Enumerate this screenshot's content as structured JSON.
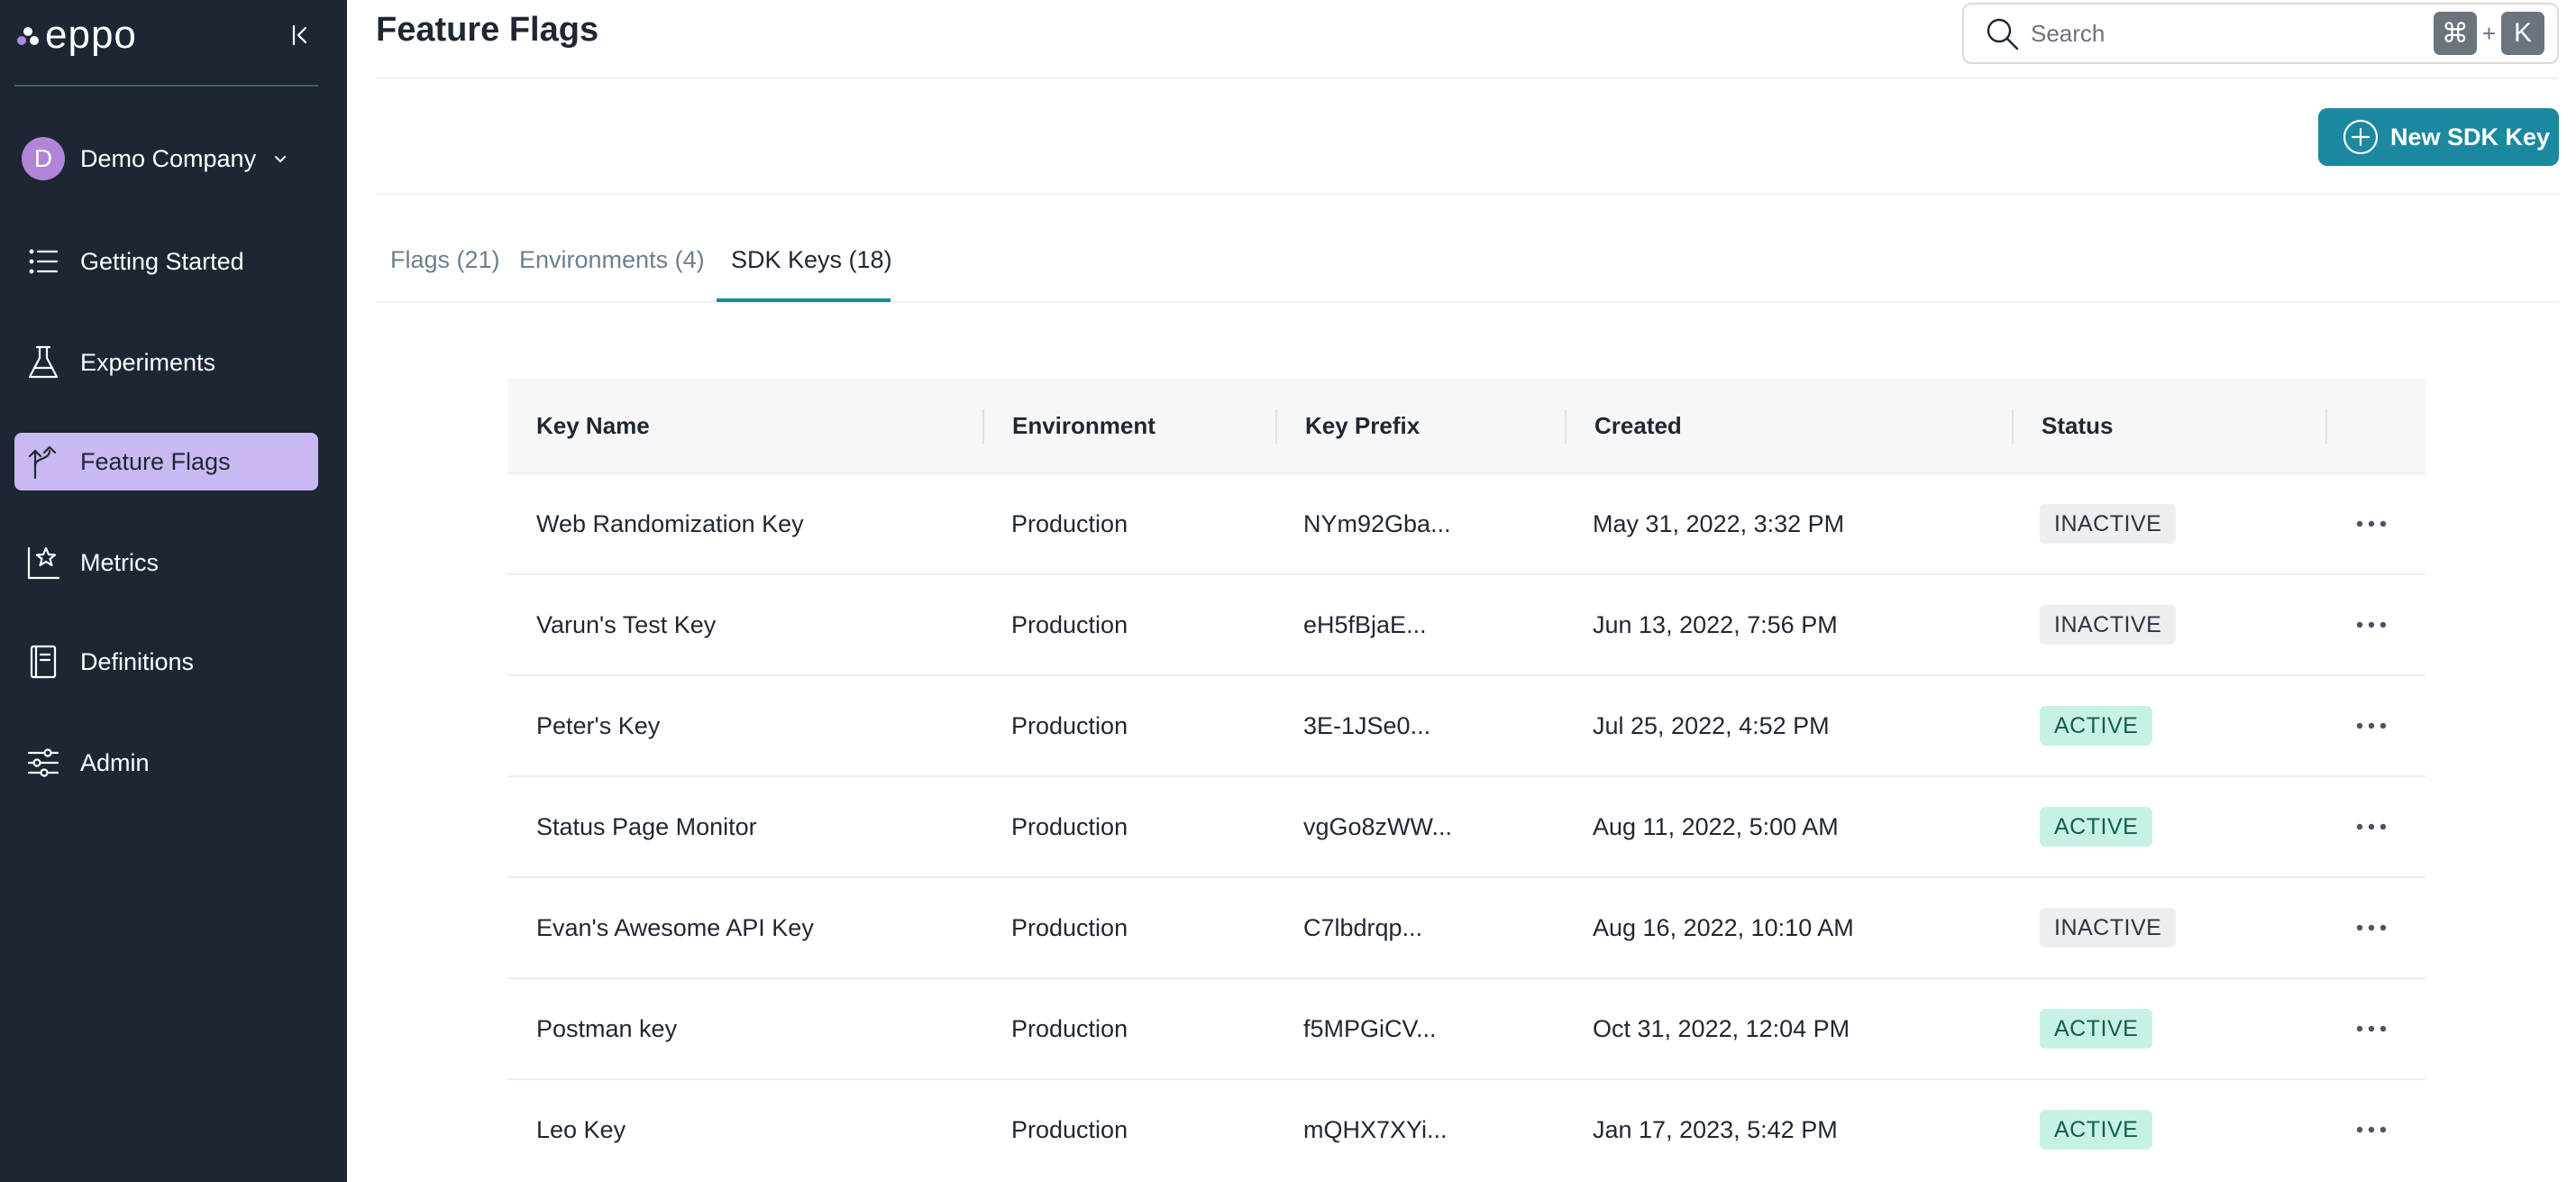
{
  "app": {
    "logo_text": "eppo"
  },
  "sidebar": {
    "company": {
      "initial": "D",
      "name": "Demo Company"
    },
    "items": [
      {
        "label": "Getting Started",
        "icon": "list-icon",
        "active": false
      },
      {
        "label": "Experiments",
        "icon": "flask-icon",
        "active": false
      },
      {
        "label": "Feature Flags",
        "icon": "flag-branch-icon",
        "active": true
      },
      {
        "label": "Metrics",
        "icon": "chart-star-icon",
        "active": false
      },
      {
        "label": "Definitions",
        "icon": "book-icon",
        "active": false
      },
      {
        "label": "Admin",
        "icon": "sliders-icon",
        "active": false
      }
    ]
  },
  "header": {
    "title": "Feature Flags",
    "search": {
      "placeholder": "Search",
      "value": "",
      "shortcut_mod": "⌘",
      "shortcut_plus": "+",
      "shortcut_key": "K"
    },
    "new_button": "New SDK Key"
  },
  "tabs": [
    {
      "label": "Flags (21)",
      "active": false
    },
    {
      "label": "Environments (4)",
      "active": false
    },
    {
      "label": "SDK Keys (18)",
      "active": true
    }
  ],
  "table": {
    "columns": [
      "Key Name",
      "Environment",
      "Key Prefix",
      "Created",
      "Status"
    ],
    "rows": [
      {
        "name": "Web Randomization Key",
        "environment": "Production",
        "prefix": "NYm92Gba...",
        "created": "May 31, 2022, 3:32 PM",
        "status": "INACTIVE"
      },
      {
        "name": "Varun's Test Key",
        "environment": "Production",
        "prefix": "eH5fBjaE...",
        "created": "Jun 13, 2022, 7:56 PM",
        "status": "INACTIVE"
      },
      {
        "name": "Peter's Key",
        "environment": "Production",
        "prefix": "3E-1JSe0...",
        "created": "Jul 25, 2022, 4:52 PM",
        "status": "ACTIVE"
      },
      {
        "name": "Status Page Monitor",
        "environment": "Production",
        "prefix": "vgGo8zWW...",
        "created": "Aug 11, 2022, 5:00 AM",
        "status": "ACTIVE"
      },
      {
        "name": "Evan's Awesome API Key",
        "environment": "Production",
        "prefix": "C7lbdrqp...",
        "created": "Aug 16, 2022, 10:10 AM",
        "status": "INACTIVE"
      },
      {
        "name": "Postman key",
        "environment": "Production",
        "prefix": "f5MPGiCV...",
        "created": "Oct 31, 2022, 12:04 PM",
        "status": "ACTIVE"
      },
      {
        "name": "Leo Key",
        "environment": "Production",
        "prefix": "mQHX7XYi...",
        "created": "Jan 17, 2023, 5:42 PM",
        "status": "ACTIVE"
      }
    ]
  },
  "colors": {
    "sidebar_bg": "#1c2733",
    "accent": "#1a89a0",
    "nav_active_bg": "#c9b8f2",
    "avatar": "#b084d9",
    "status_active_bg": "#c8f1e6",
    "status_inactive_bg": "#eceef1"
  }
}
